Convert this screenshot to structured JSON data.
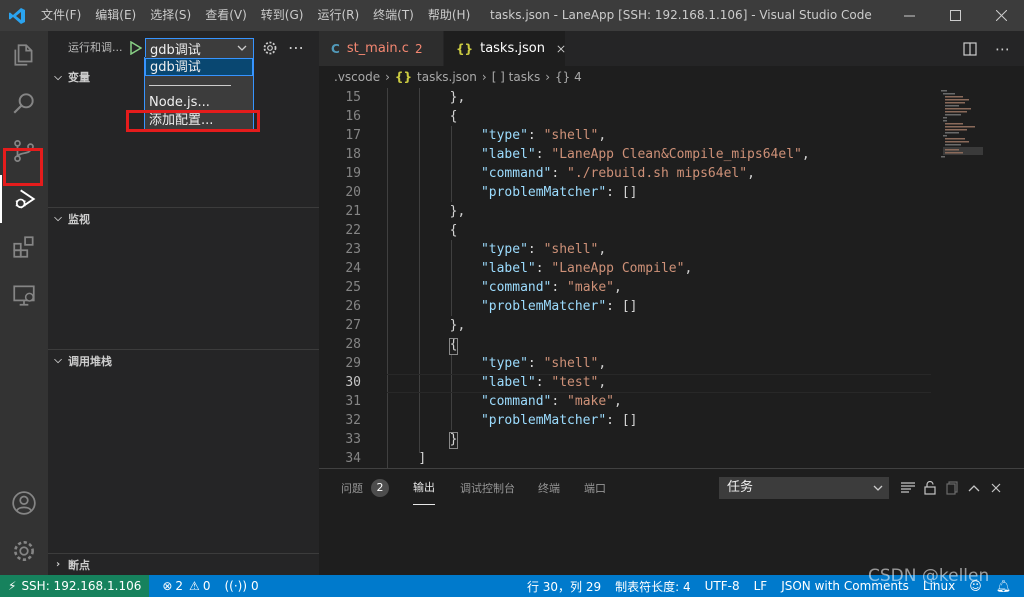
{
  "menubar": [
    "文件(F)",
    "编辑(E)",
    "选择(S)",
    "查看(V)",
    "转到(G)",
    "运行(R)",
    "终端(T)",
    "帮助(H)"
  ],
  "window_title": "tasks.json - LaneApp [SSH: 192.168.1.106] - Visual Studio Code",
  "activity": {
    "items": [
      "files-icon",
      "search-icon",
      "source-control-icon",
      "run-debug-icon",
      "extensions-icon",
      "remote-explorer-icon"
    ],
    "bottom": [
      "account-icon",
      "settings-gear-icon"
    ],
    "active": "run-debug-icon"
  },
  "sidebar": {
    "title": "运行和调...",
    "config_value": "gdb调试",
    "sections": [
      "变量",
      "监视",
      "调用堆栈",
      "断点"
    ]
  },
  "dropdown": {
    "options": [
      "gdb调试",
      "Node.js...",
      "添加配置..."
    ],
    "selected": "gdb调试",
    "highlighted": "添加配置..."
  },
  "tabs": [
    {
      "icon": "C",
      "label": "st_main.c",
      "badge": "2",
      "active": false
    },
    {
      "icon": "{}",
      "label": "tasks.json",
      "active": true
    }
  ],
  "breadcrumb": [
    ".vscode",
    "tasks.json",
    "[ ] tasks",
    "{} 4"
  ],
  "code": {
    "lines": [
      {
        "n": "15",
        "t": "        },"
      },
      {
        "n": "16",
        "t": "        {"
      },
      {
        "n": "17",
        "t": "            \"type\": \"shell\","
      },
      {
        "n": "18",
        "t": "            \"label\": \"LaneApp Clean&Compile_mips64el\","
      },
      {
        "n": "19",
        "t": "            \"command\": \"./rebuild.sh mips64el\","
      },
      {
        "n": "20",
        "t": "            \"problemMatcher\": []"
      },
      {
        "n": "21",
        "t": "        },"
      },
      {
        "n": "22",
        "t": "        {"
      },
      {
        "n": "23",
        "t": "            \"type\": \"shell\","
      },
      {
        "n": "24",
        "t": "            \"label\": \"LaneApp Compile\","
      },
      {
        "n": "25",
        "t": "            \"command\": \"make\","
      },
      {
        "n": "26",
        "t": "            \"problemMatcher\": []"
      },
      {
        "n": "27",
        "t": "        },"
      },
      {
        "n": "28",
        "t": "        {"
      },
      {
        "n": "29",
        "t": "            \"type\": \"shell\","
      },
      {
        "n": "30",
        "t": "            \"label\": \"test\","
      },
      {
        "n": "31",
        "t": "            \"command\": \"make\","
      },
      {
        "n": "32",
        "t": "            \"problemMatcher\": []"
      },
      {
        "n": "33",
        "t": "        }"
      },
      {
        "n": "34",
        "t": "    ]"
      }
    ],
    "active_line": "30"
  },
  "panel": {
    "tabs": [
      {
        "label": "问题",
        "badge": "2"
      },
      {
        "label": "输出"
      },
      {
        "label": "调试控制台"
      },
      {
        "label": "终端"
      },
      {
        "label": "端口"
      }
    ],
    "active_tab": "输出",
    "task_select": "任务"
  },
  "statusbar": {
    "remote": "SSH: 192.168.1.106",
    "errors": "2",
    "warnings": "0",
    "ports": "0",
    "position": "行 30，列 29",
    "indent": "制表符长度: 4",
    "encoding": "UTF-8",
    "eol": "LF",
    "language": "JSON with Comments",
    "os": "Linux"
  },
  "watermark": "CSDN @kellen",
  "colors": {
    "accent": "#007acc",
    "remote": "#16825d",
    "highlight_box": "#e51c1c",
    "json_key": "#9cdcfe",
    "json_string": "#ce9178"
  }
}
